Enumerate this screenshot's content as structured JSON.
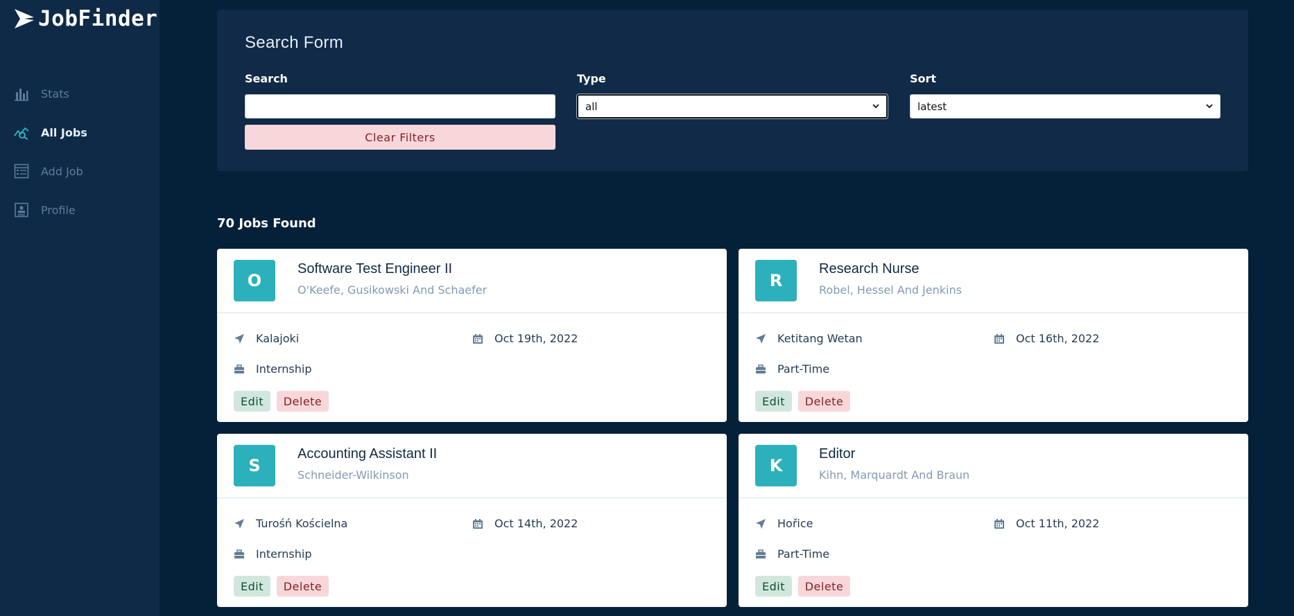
{
  "app": {
    "name": "JobFinder"
  },
  "sidebar": {
    "items": [
      {
        "label": "Stats",
        "icon": "bar-chart-icon",
        "active": false
      },
      {
        "label": "All Jobs",
        "icon": "query-stats-icon",
        "active": true
      },
      {
        "label": "Add Job",
        "icon": "form-icon",
        "active": false
      },
      {
        "label": "Profile",
        "icon": "id-card-icon",
        "active": false
      }
    ]
  },
  "search_form": {
    "title": "Search Form",
    "search_label": "Search",
    "search_value": "",
    "type_label": "Type",
    "type_value": "all",
    "sort_label": "Sort",
    "sort_value": "latest",
    "clear_label": "Clear Filters"
  },
  "results": {
    "count_text": "70 Jobs Found"
  },
  "jobs": [
    {
      "initial": "O",
      "title": "Software Test Engineer II",
      "company": "O'Keefe, Gusikowski And Schaefer",
      "location": "Kalajoki",
      "date": "Oct 19th, 2022",
      "type": "Internship",
      "edit_label": "Edit",
      "delete_label": "Delete"
    },
    {
      "initial": "R",
      "title": "Research Nurse",
      "company": "Robel, Hessel And Jenkins",
      "location": "Ketitang Wetan",
      "date": "Oct 16th, 2022",
      "type": "Part-Time",
      "edit_label": "Edit",
      "delete_label": "Delete"
    },
    {
      "initial": "S",
      "title": "Accounting Assistant II",
      "company": "Schneider-Wilkinson",
      "location": "Turośń Kościelna",
      "date": "Oct 14th, 2022",
      "type": "Internship",
      "edit_label": "Edit",
      "delete_label": "Delete"
    },
    {
      "initial": "K",
      "title": "Editor",
      "company": "Kihn, Marquardt And Braun",
      "location": "Hořice",
      "date": "Oct 11th, 2022",
      "type": "Part-Time",
      "edit_label": "Edit",
      "delete_label": "Delete"
    }
  ],
  "colors": {
    "accent": "#2cb1bc",
    "sidebar_bg": "#0e2a47",
    "page_bg": "#052039"
  }
}
